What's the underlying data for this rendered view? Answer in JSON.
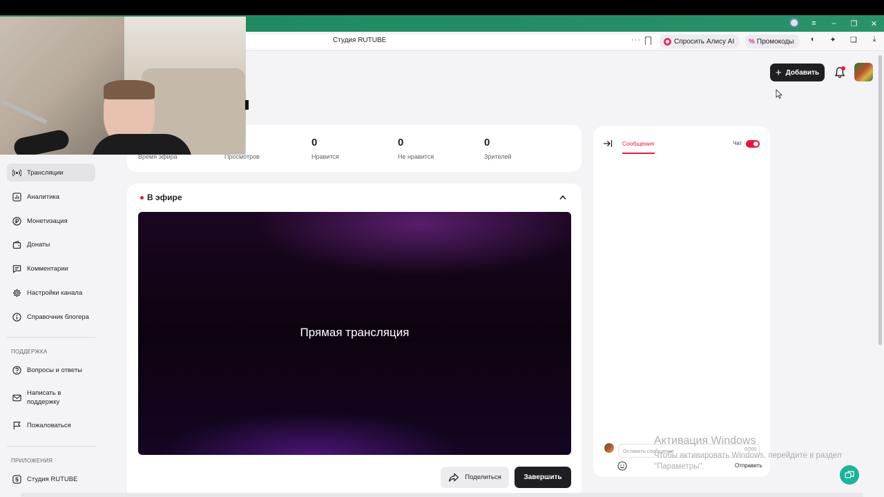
{
  "browser": {
    "tab_title": "Студия RUTUBE",
    "alice_label": "Спросить Алису AI",
    "promo_label": "Промокоды",
    "promo_symbol": "%",
    "more_dots": "···"
  },
  "header": {
    "add_label": "Добавить",
    "add_symbol": "+"
  },
  "stats": [
    {
      "value": "",
      "label": "Время эфира"
    },
    {
      "value": "",
      "label": "Просмотров"
    },
    {
      "value": "0",
      "label": "Нравится"
    },
    {
      "value": "0",
      "label": "Не нравится"
    },
    {
      "value": "0",
      "label": "Зрителей"
    }
  ],
  "sidebar": {
    "items": [
      {
        "label": "Трансляции",
        "icon": "broadcast-icon",
        "active": true
      },
      {
        "label": "Аналитика",
        "icon": "analytics-icon"
      },
      {
        "label": "Монетизация",
        "icon": "ruble-icon"
      },
      {
        "label": "Донаты",
        "icon": "wallet-icon"
      },
      {
        "label": "Комментарии",
        "icon": "comment-icon"
      },
      {
        "label": "Настройки канала",
        "icon": "gear-icon"
      },
      {
        "label": "Справочник блогера",
        "icon": "info-icon"
      }
    ],
    "support_header": "ПОДДЕРЖКА",
    "support_items": [
      {
        "label": "Вопросы и ответы",
        "icon": "question-icon"
      },
      {
        "label": "Написать в поддержку",
        "icon": "mail-icon"
      },
      {
        "label": "Пожаловаться",
        "icon": "flag-icon"
      }
    ],
    "apps_header": "ПРИЛОЖЕНИЯ",
    "apps_items": [
      {
        "label": "Студия RUTUBE",
        "icon": "studio-icon"
      }
    ]
  },
  "live": {
    "title": "В эфире",
    "player_text": "Прямая трансляция",
    "share_label": "Поделиться",
    "end_label": "Завершить"
  },
  "chat": {
    "tab_messages": "Сообщения",
    "chat_label": "Чат",
    "chat_enabled": true,
    "input_placeholder": "Оставить сообщение",
    "char_count": "0/200",
    "send_label": "Отправить"
  },
  "watermark": {
    "title": "Активация Windows",
    "text": "Чтобы активировать Windows, перейдите в раздел \"Параметры\"."
  },
  "colors": {
    "accent": "#ed143b",
    "titlebar": "#238c64",
    "dark_button": "#1f1f23",
    "fab": "#1bb39a"
  }
}
